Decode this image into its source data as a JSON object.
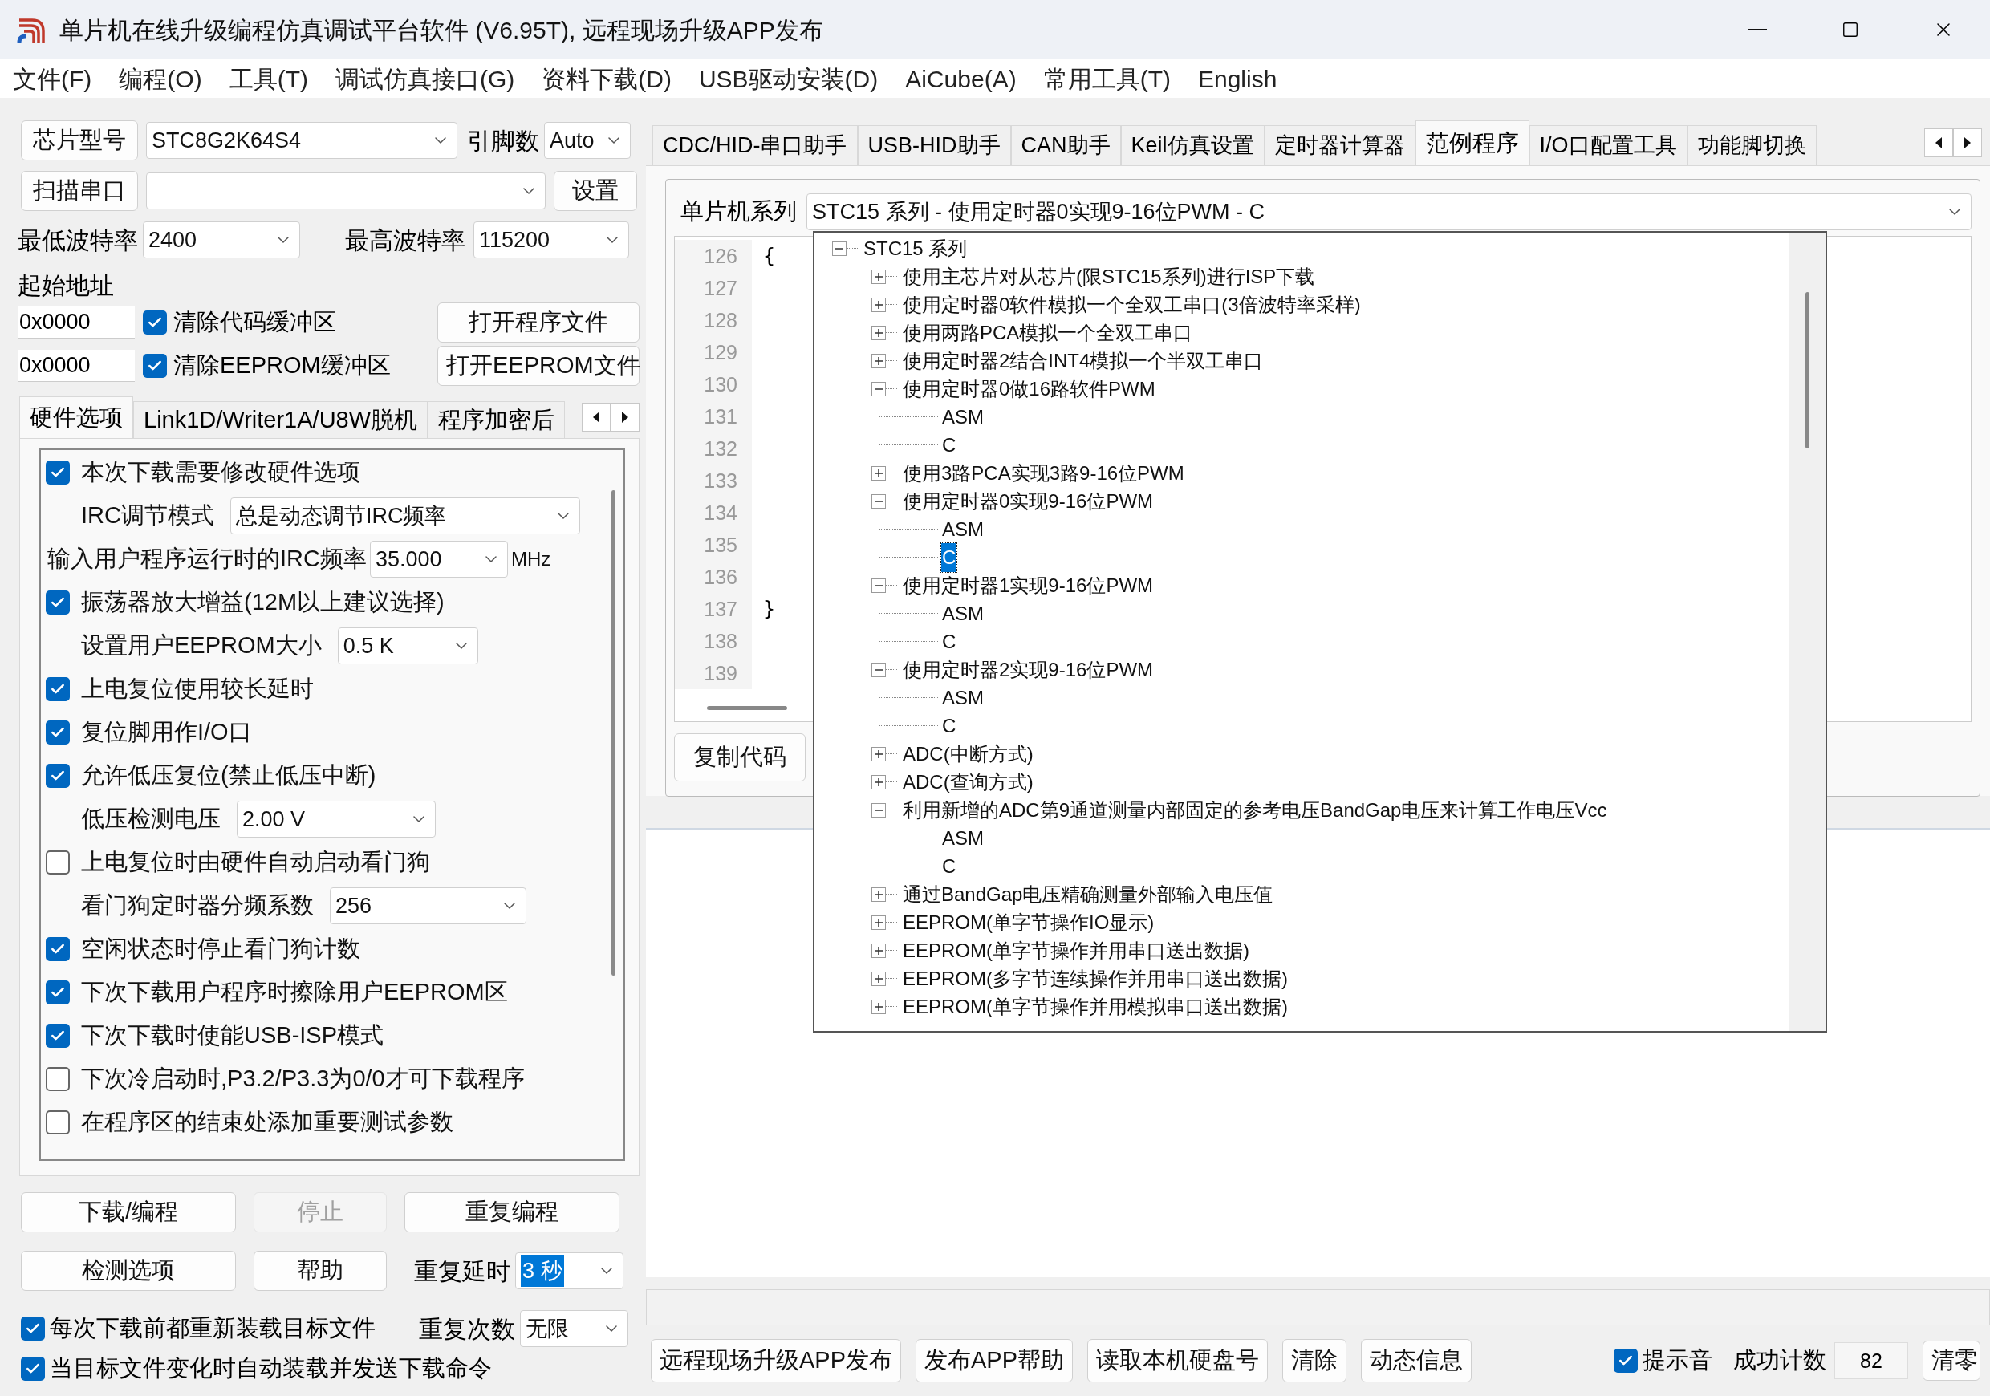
{
  "window": {
    "title": "单片机在线升级编程仿真调试平台软件 (V6.95T), 远程现场升级APP发布"
  },
  "menu": [
    "文件(F)",
    "编程(O)",
    "工具(T)",
    "调试仿真接口(G)",
    "资料下载(D)",
    "USB驱动安装(D)",
    "AiCube(A)",
    "常用工具(T)",
    "English"
  ],
  "chip": {
    "button": "芯片型号",
    "value": "STC8G2K64S4",
    "pins_label": "引脚数",
    "pins_value": "Auto"
  },
  "port": {
    "button": "扫描串口",
    "settings_button": "设置"
  },
  "baud": {
    "min_label": "最低波特率",
    "min_value": "2400",
    "max_label": "最高波特率",
    "max_value": "115200"
  },
  "start_address": {
    "label": "起始地址",
    "rows": [
      {
        "value": "0x0000",
        "checkbox": "清除代码缓冲区",
        "checked": true,
        "button": "打开程序文件"
      },
      {
        "value": "0x0000",
        "checkbox": "清除EEPROM缓冲区",
        "checked": true,
        "button": "打开EEPROM文件"
      }
    ]
  },
  "left_tabs": [
    {
      "label": "硬件选项",
      "selected": true
    },
    {
      "label": "Link1D/Writer1A/U8W脱机",
      "selected": false
    },
    {
      "label": "程序加密后",
      "selected": false
    }
  ],
  "hardware_options": [
    {
      "kind": "checkbox",
      "label": "本次下载需要修改硬件选项",
      "checked": true
    },
    {
      "kind": "select",
      "label": "IRC调节模式",
      "value": "总是动态调节IRC频率"
    },
    {
      "kind": "select",
      "label": "输入用户程序运行时的IRC频率",
      "value": "35.000",
      "unit": "MHz"
    },
    {
      "kind": "checkbox",
      "label": "振荡器放大增益(12M以上建议选择)",
      "checked": true
    },
    {
      "kind": "select",
      "label": "设置用户EEPROM大小",
      "value": "0.5 K"
    },
    {
      "kind": "checkbox",
      "label": "上电复位使用较长延时",
      "checked": true
    },
    {
      "kind": "checkbox",
      "label": "复位脚用作I/O口",
      "checked": true
    },
    {
      "kind": "checkbox",
      "label": "允许低压复位(禁止低压中断)",
      "checked": true
    },
    {
      "kind": "select",
      "label": "低压检测电压",
      "value": "2.00 V"
    },
    {
      "kind": "checkbox",
      "label": "上电复位时由硬件自动启动看门狗",
      "checked": false
    },
    {
      "kind": "select",
      "label": "看门狗定时器分频系数",
      "value": "256"
    },
    {
      "kind": "checkbox",
      "label": "空闲状态时停止看门狗计数",
      "checked": true
    },
    {
      "kind": "checkbox",
      "label": "下次下载用户程序时擦除用户EEPROM区",
      "checked": true
    },
    {
      "kind": "checkbox",
      "label": "下次下载时使能USB-ISP模式",
      "checked": true
    },
    {
      "kind": "checkbox",
      "label": "下次冷启动时,P3.2/P3.3为0/0才可下载程序",
      "checked": false
    },
    {
      "kind": "checkbox",
      "label": "在程序区的结束处添加重要测试参数",
      "checked": false
    }
  ],
  "actions": {
    "buttons": [
      {
        "label": "下载/编程",
        "disabled": false
      },
      {
        "label": "停止",
        "disabled": true
      },
      {
        "label": "重复编程",
        "disabled": false
      },
      {
        "label": "检测选项",
        "disabled": false
      },
      {
        "label": "帮助",
        "disabled": false
      }
    ],
    "repeat_delay": {
      "label": "重复延时",
      "value": "3 秒",
      "focused": true
    },
    "repeat_count": {
      "label": "重复次数",
      "value": "无限",
      "focused": false
    }
  },
  "bottom_checks": [
    {
      "label": "每次下载前都重新装载目标文件",
      "checked": true
    },
    {
      "label": "当目标文件变化时自动装载并发送下载命令",
      "checked": true
    }
  ],
  "right_tabs": [
    {
      "label": "CDC/HID-串口助手",
      "selected": false
    },
    {
      "label": "USB-HID助手",
      "selected": false
    },
    {
      "label": "CAN助手",
      "selected": false
    },
    {
      "label": "Keil仿真设置",
      "selected": false
    },
    {
      "label": "定时器计算器",
      "selected": false
    },
    {
      "label": "范例程序",
      "selected": true
    },
    {
      "label": "I/O口配置工具",
      "selected": false
    },
    {
      "label": "功能脚切换",
      "selected": false
    }
  ],
  "examples": {
    "series_label": "单片机系列",
    "series_value": "STC15 系列 - 使用定时器0实现9-16位PWM - C",
    "code_lines": [
      {
        "number": "126",
        "text": "{"
      },
      {
        "number": "127"
      },
      {
        "number": "128"
      },
      {
        "number": "129"
      },
      {
        "number": "130"
      },
      {
        "number": "131"
      },
      {
        "number": "132"
      },
      {
        "number": "133"
      },
      {
        "number": "134"
      },
      {
        "number": "135"
      },
      {
        "number": "136"
      },
      {
        "number": "137",
        "text": "}"
      },
      {
        "number": "138"
      },
      {
        "number": "139"
      }
    ],
    "copy_button": "复制代码",
    "tree": [
      {
        "kind": "group",
        "label": "STC15 系列",
        "expanded": true,
        "selected": false,
        "children": [
          {
            "kind": "group",
            "label": "使用主芯片对从芯片(限STC15系列)进行ISP下载",
            "expanded": false,
            "selected": false
          },
          {
            "kind": "group",
            "label": "使用定时器0软件模拟一个全双工串口(3倍波特率采样)",
            "expanded": false,
            "selected": false
          },
          {
            "kind": "group",
            "label": "使用两路PCA模拟一个全双工串口",
            "expanded": false,
            "selected": false
          },
          {
            "kind": "group",
            "label": "使用定时器2结合INT4模拟一个半双工串口",
            "expanded": false,
            "selected": false
          },
          {
            "kind": "group",
            "label": "使用定时器0做16路软件PWM",
            "expanded": true,
            "selected": false,
            "children": [
              {
                "kind": "leaf",
                "label": "ASM",
                "selected": false
              },
              {
                "kind": "leaf",
                "label": "C",
                "selected": false
              }
            ]
          },
          {
            "kind": "group",
            "label": "使用3路PCA实现3路9-16位PWM",
            "expanded": false,
            "selected": false
          },
          {
            "kind": "group",
            "label": "使用定时器0实现9-16位PWM",
            "expanded": true,
            "selected": false,
            "children": [
              {
                "kind": "leaf",
                "label": "ASM",
                "selected": false
              },
              {
                "kind": "leaf",
                "label": "C",
                "selected": true
              }
            ]
          },
          {
            "kind": "group",
            "label": "使用定时器1实现9-16位PWM",
            "expanded": true,
            "selected": false,
            "children": [
              {
                "kind": "leaf",
                "label": "ASM",
                "selected": false
              },
              {
                "kind": "leaf",
                "label": "C",
                "selected": false
              }
            ]
          },
          {
            "kind": "group",
            "label": "使用定时器2实现9-16位PWM",
            "expanded": true,
            "selected": false,
            "children": [
              {
                "kind": "leaf",
                "label": "ASM",
                "selected": false
              },
              {
                "kind": "leaf",
                "label": "C",
                "selected": false
              }
            ]
          },
          {
            "kind": "group",
            "label": "ADC(中断方式)",
            "expanded": false,
            "selected": false
          },
          {
            "kind": "group",
            "label": "ADC(查询方式)",
            "expanded": false,
            "selected": false
          },
          {
            "kind": "group",
            "label": "利用新增的ADC第9通道测量内部固定的参考电压BandGap电压来计算工作电压Vcc",
            "expanded": true,
            "selected": false,
            "children": [
              {
                "kind": "leaf",
                "label": "ASM",
                "selected": false
              },
              {
                "kind": "leaf",
                "label": "C",
                "selected": false
              }
            ]
          },
          {
            "kind": "group",
            "label": "通过BandGap电压精确测量外部输入电压值",
            "expanded": false,
            "selected": false
          },
          {
            "kind": "group",
            "label": "EEPROM(单字节操作IO显示)",
            "expanded": false,
            "selected": false
          },
          {
            "kind": "group",
            "label": "EEPROM(单字节操作并用串口送出数据)",
            "expanded": false,
            "selected": false
          },
          {
            "kind": "group",
            "label": "EEPROM(多字节连续操作并用串口送出数据)",
            "expanded": false,
            "selected": false
          },
          {
            "kind": "group",
            "label": "EEPROM(单字节操作并用模拟串口送出数据)",
            "expanded": false,
            "selected": false
          }
        ]
      }
    ]
  },
  "progress": {
    "level": 0
  },
  "bottom_bar": {
    "buttons": [
      "远程现场升级APP发布",
      "发布APP帮助",
      "读取本机硬盘号",
      "清除",
      "动态信息"
    ],
    "sound": {
      "label": "提示音",
      "checked": true
    },
    "success_label": "成功计数",
    "success_count": "82",
    "reset_button": "清零"
  }
}
